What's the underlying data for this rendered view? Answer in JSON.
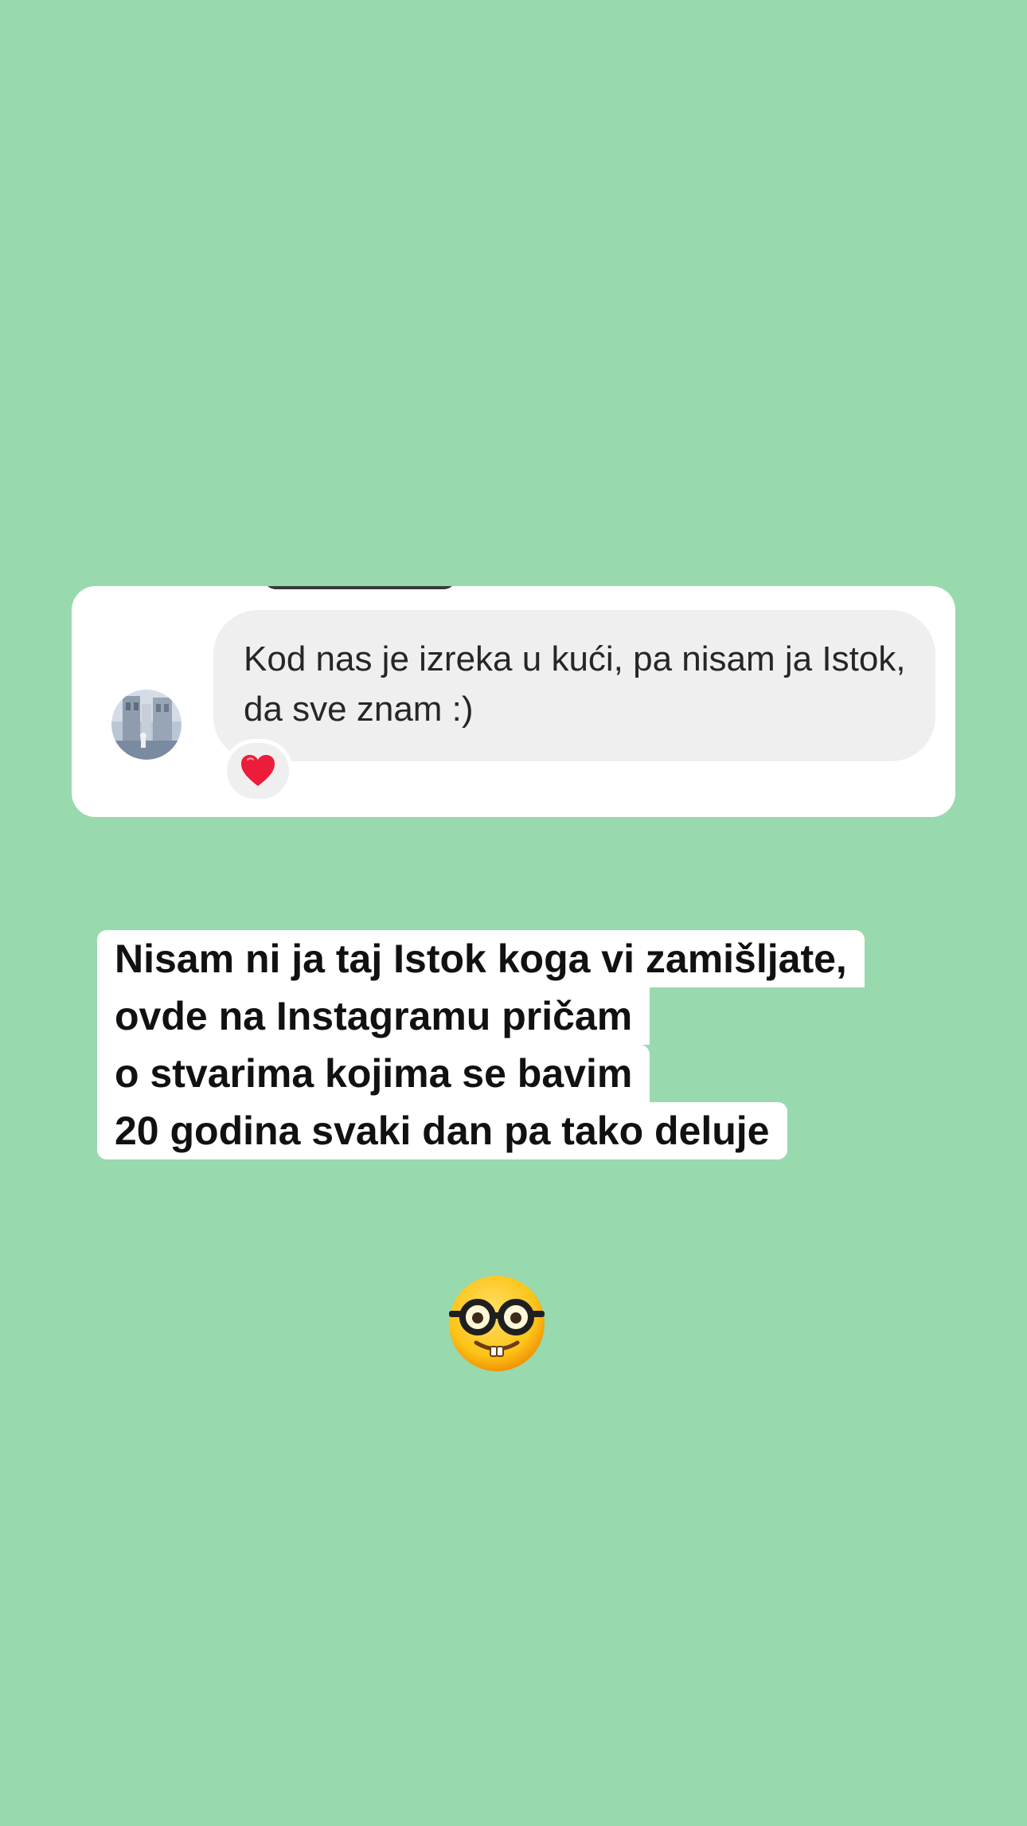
{
  "background_color": "#98d9ae",
  "dm_card": {
    "message_text": "Kod nas je izreka u kući, pa nisam ja Istok, da sve znam :)",
    "reaction_emoji": "heart-icon",
    "reaction_color": "#ed1c3a",
    "avatar_icon": "user-avatar-photo"
  },
  "caption": {
    "lines": [
      "Nisam ni ja taj Istok koga vi zamišljate,",
      "ovde na Instagramu pričam",
      "o stvarima kojima se bavim",
      "20 godina svaki dan pa tako deluje"
    ]
  },
  "sticker": {
    "emoji": "nerd-face-icon"
  }
}
